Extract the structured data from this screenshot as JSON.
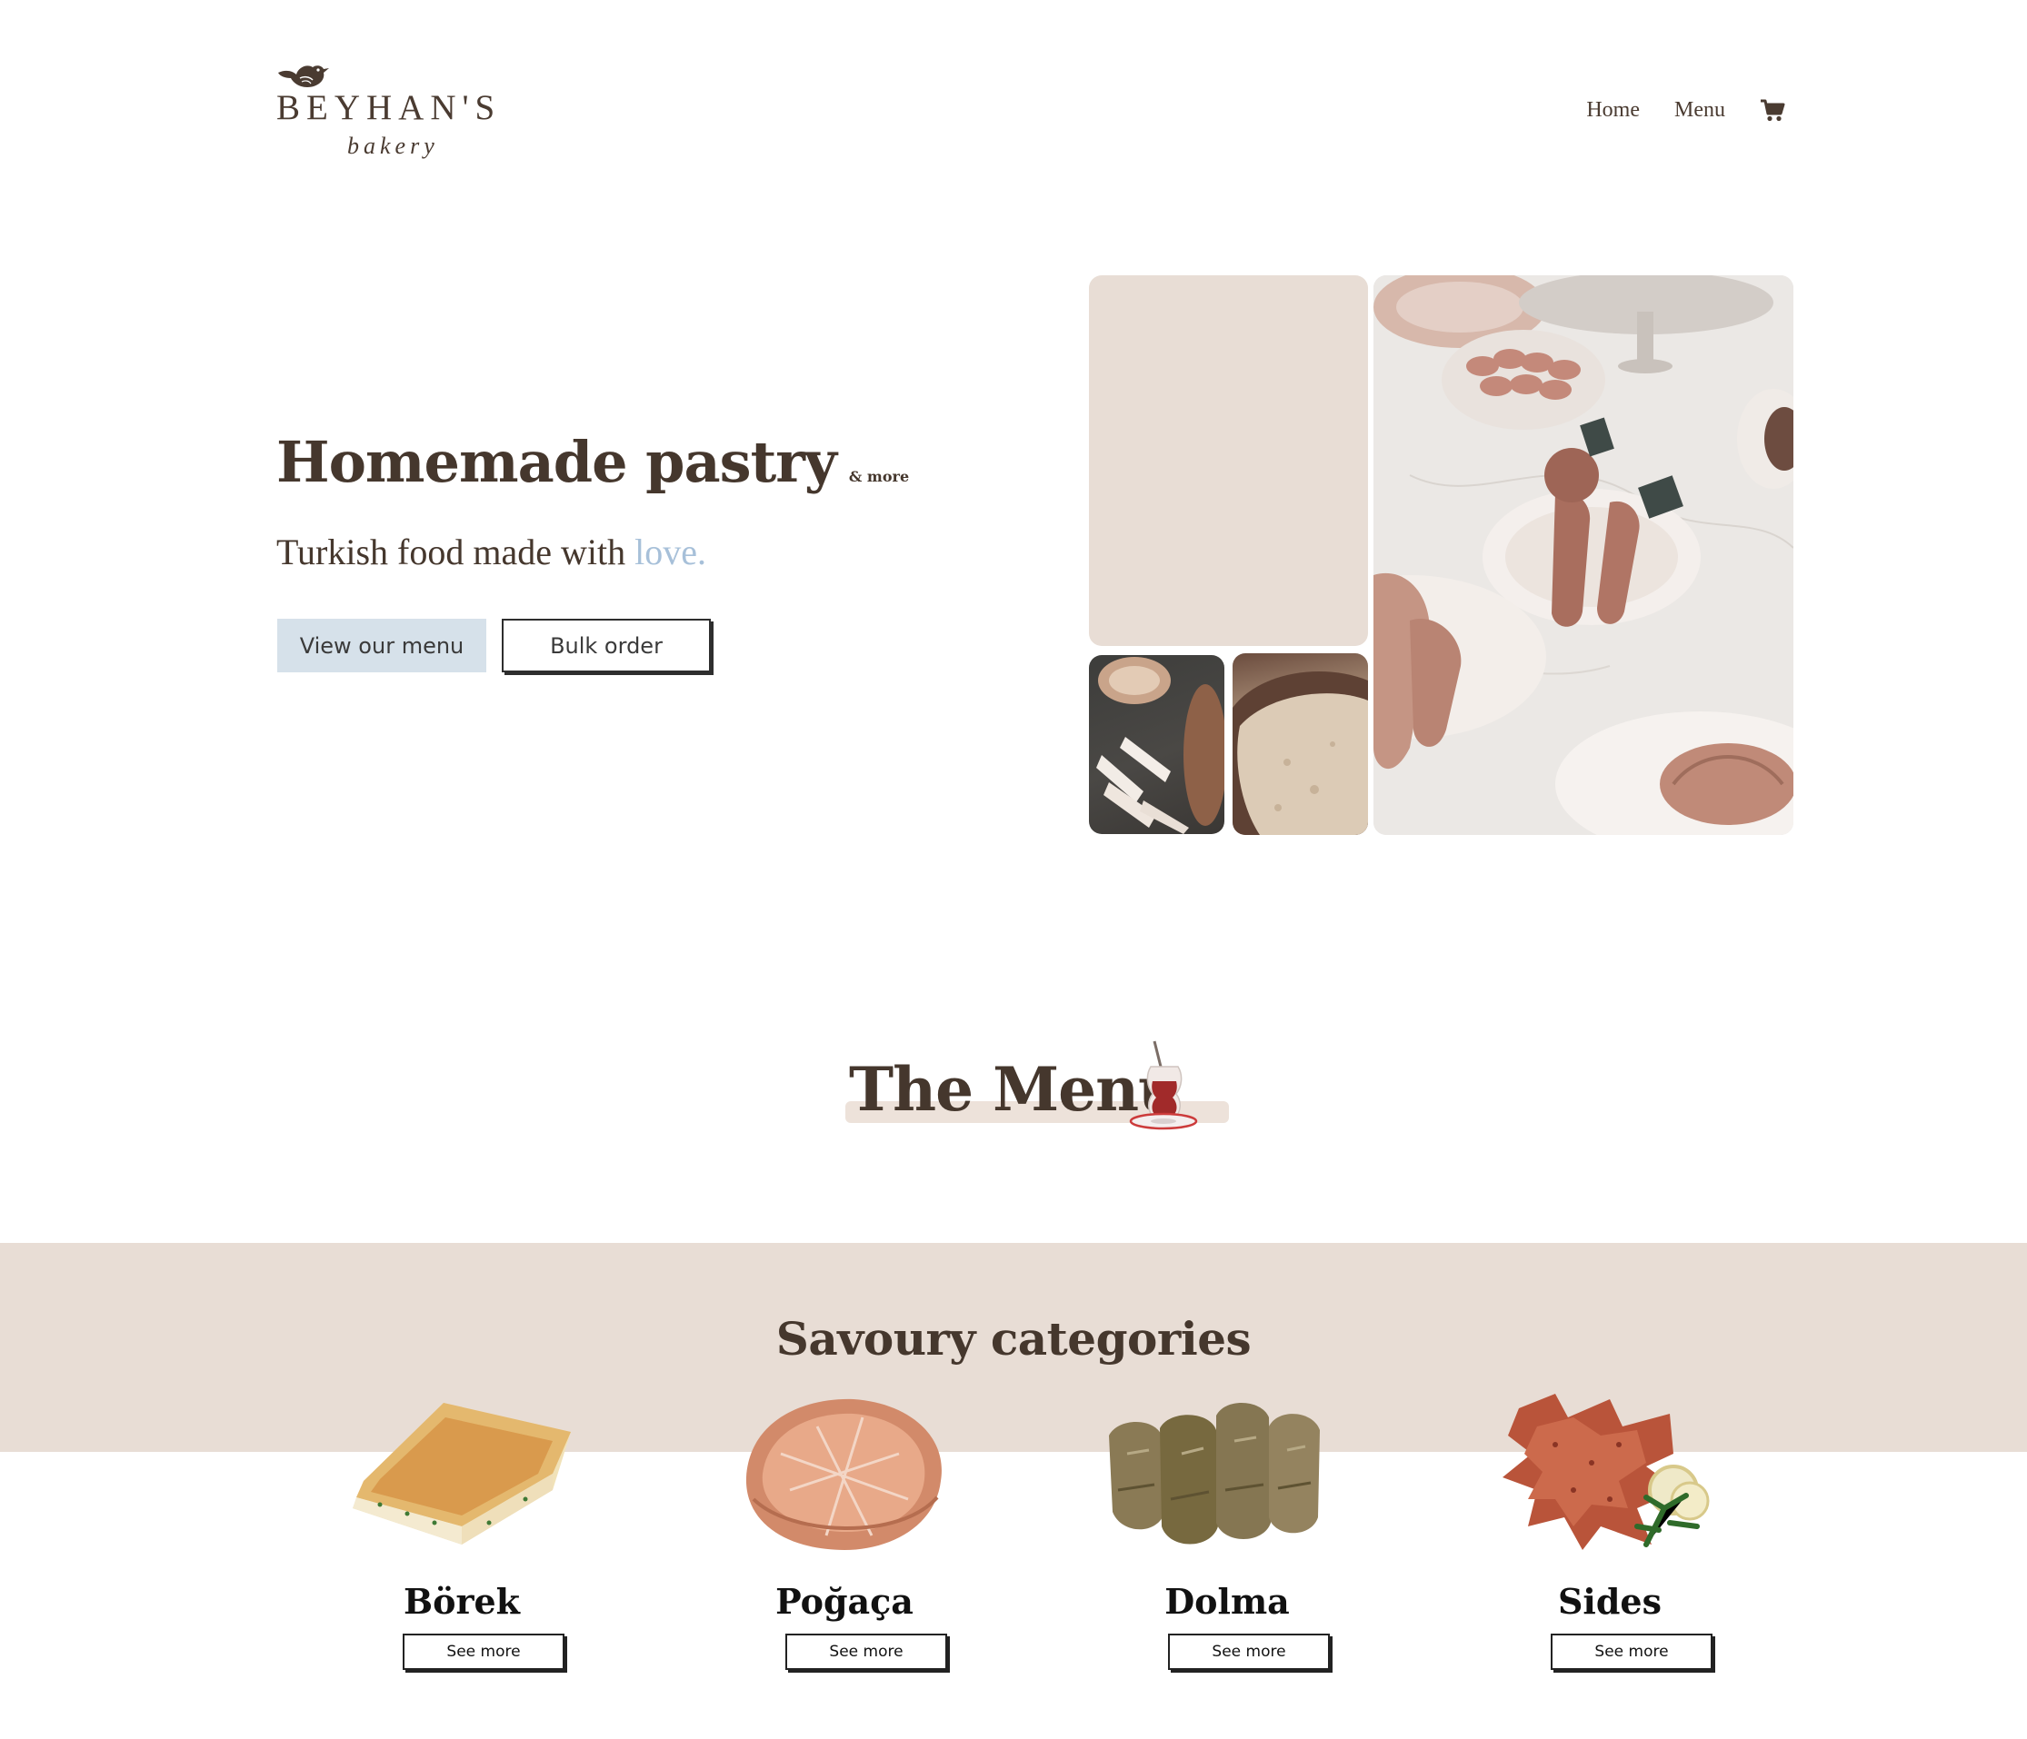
{
  "brand": {
    "name": "BEYHAN'S",
    "tagline": "bakery"
  },
  "nav": {
    "home": "Home",
    "menu": "Menu"
  },
  "hero": {
    "title": "Homemade pastry",
    "title_suffix": "& more",
    "subtitle_lead": "Turkish food made with",
    "subtitle_accent": "love.",
    "primary_button": "View our menu",
    "secondary_button": "Bulk order"
  },
  "menu_section": {
    "heading": "The Menu"
  },
  "categories": {
    "heading": "Savoury categories",
    "items": [
      {
        "name": "Börek",
        "button": "See more"
      },
      {
        "name": "Poğaça",
        "button": "See more"
      },
      {
        "name": "Dolma",
        "button": "See more"
      },
      {
        "name": "Sides",
        "button": "See more"
      }
    ]
  },
  "colors": {
    "text_brown": "#45372d",
    "accent_blue": "#a7c0d9",
    "button_blue": "#d6e1ea",
    "band_beige": "#e8ddd5"
  }
}
